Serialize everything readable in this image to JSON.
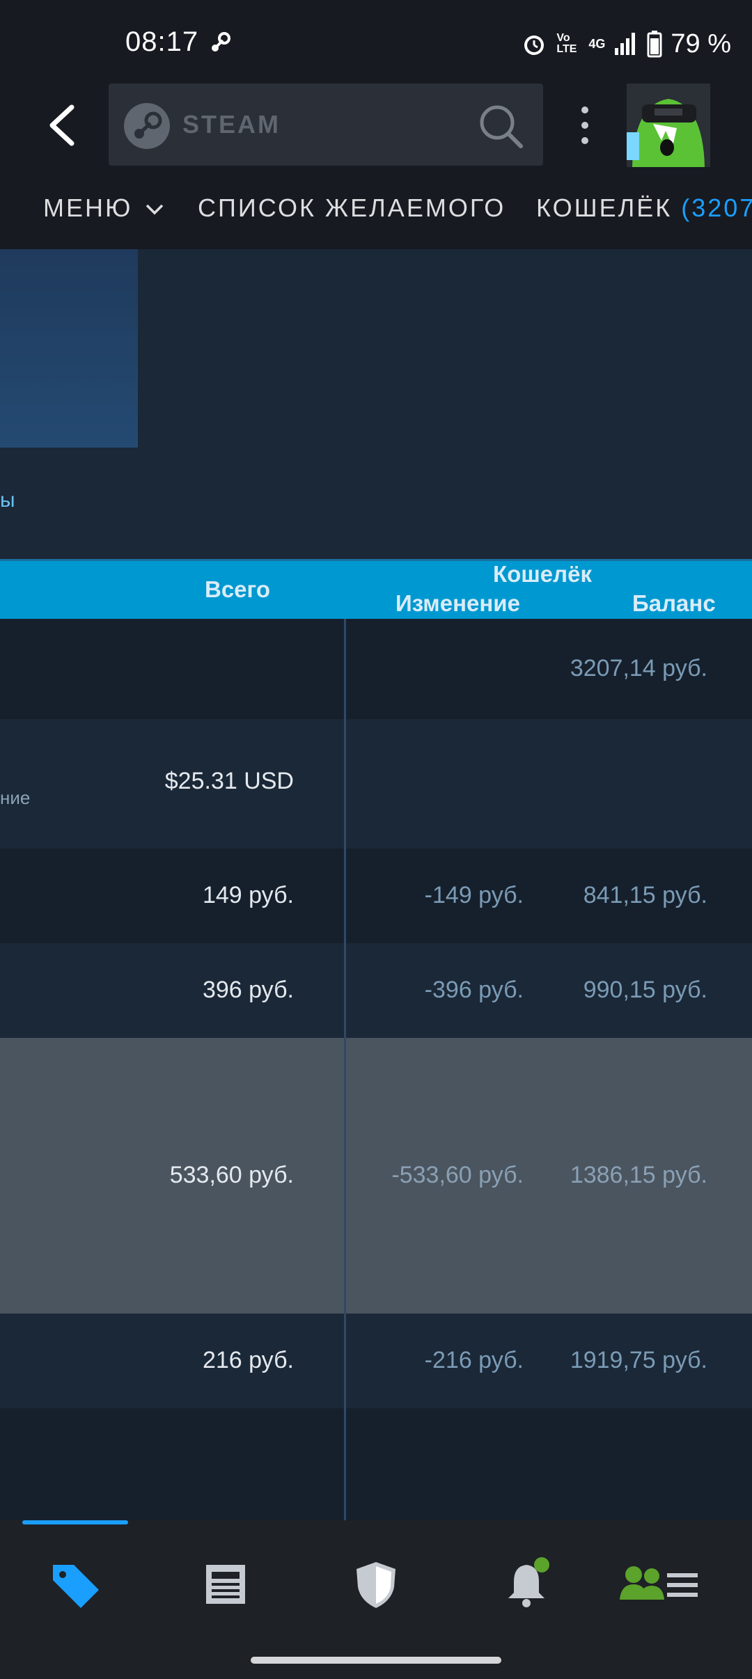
{
  "status_bar": {
    "time": "08:17",
    "network": "4G",
    "volte": "Vo LTE",
    "battery": "79 %"
  },
  "header": {
    "search_wordmark": "STEAM"
  },
  "nav": {
    "menu_label": "МЕНЮ",
    "wishlist_label": "СПИСОК ЖЕЛАЕМОГО",
    "wallet_label": "КОШЕЛЁК",
    "wallet_count": "(3207"
  },
  "content": {
    "partial_link": "ы"
  },
  "table": {
    "headers": {
      "total": "Всего",
      "wallet": "Кошелёк",
      "change": "Изменение",
      "balance": "Баланс"
    },
    "rows": [
      {
        "total": "",
        "sub": "",
        "change": "",
        "balance": "3207,14 руб."
      },
      {
        "total": "$25.31 USD",
        "sub": "ние",
        "change": "",
        "balance": ""
      },
      {
        "total": "149 руб.",
        "sub": "",
        "change": "-149 руб.",
        "balance": "841,15 руб."
      },
      {
        "total": "396 руб.",
        "sub": "",
        "change": "-396 руб.",
        "balance": "990,15 руб."
      },
      {
        "total": "533,60 руб.",
        "sub": "",
        "change": "-533,60 руб.",
        "balance": "1386,15 руб."
      },
      {
        "total": "216 руб.",
        "sub": "",
        "change": "-216 руб.",
        "balance": "1919,75 руб."
      }
    ]
  },
  "bottom_nav": {
    "tabs": [
      "store-tag-icon",
      "news-icon",
      "shield-icon",
      "bell-icon",
      "friends-icon"
    ]
  },
  "colors": {
    "accent": "#1a9fff",
    "header_bg": "#0098d0",
    "notification": "#5ba32b"
  }
}
